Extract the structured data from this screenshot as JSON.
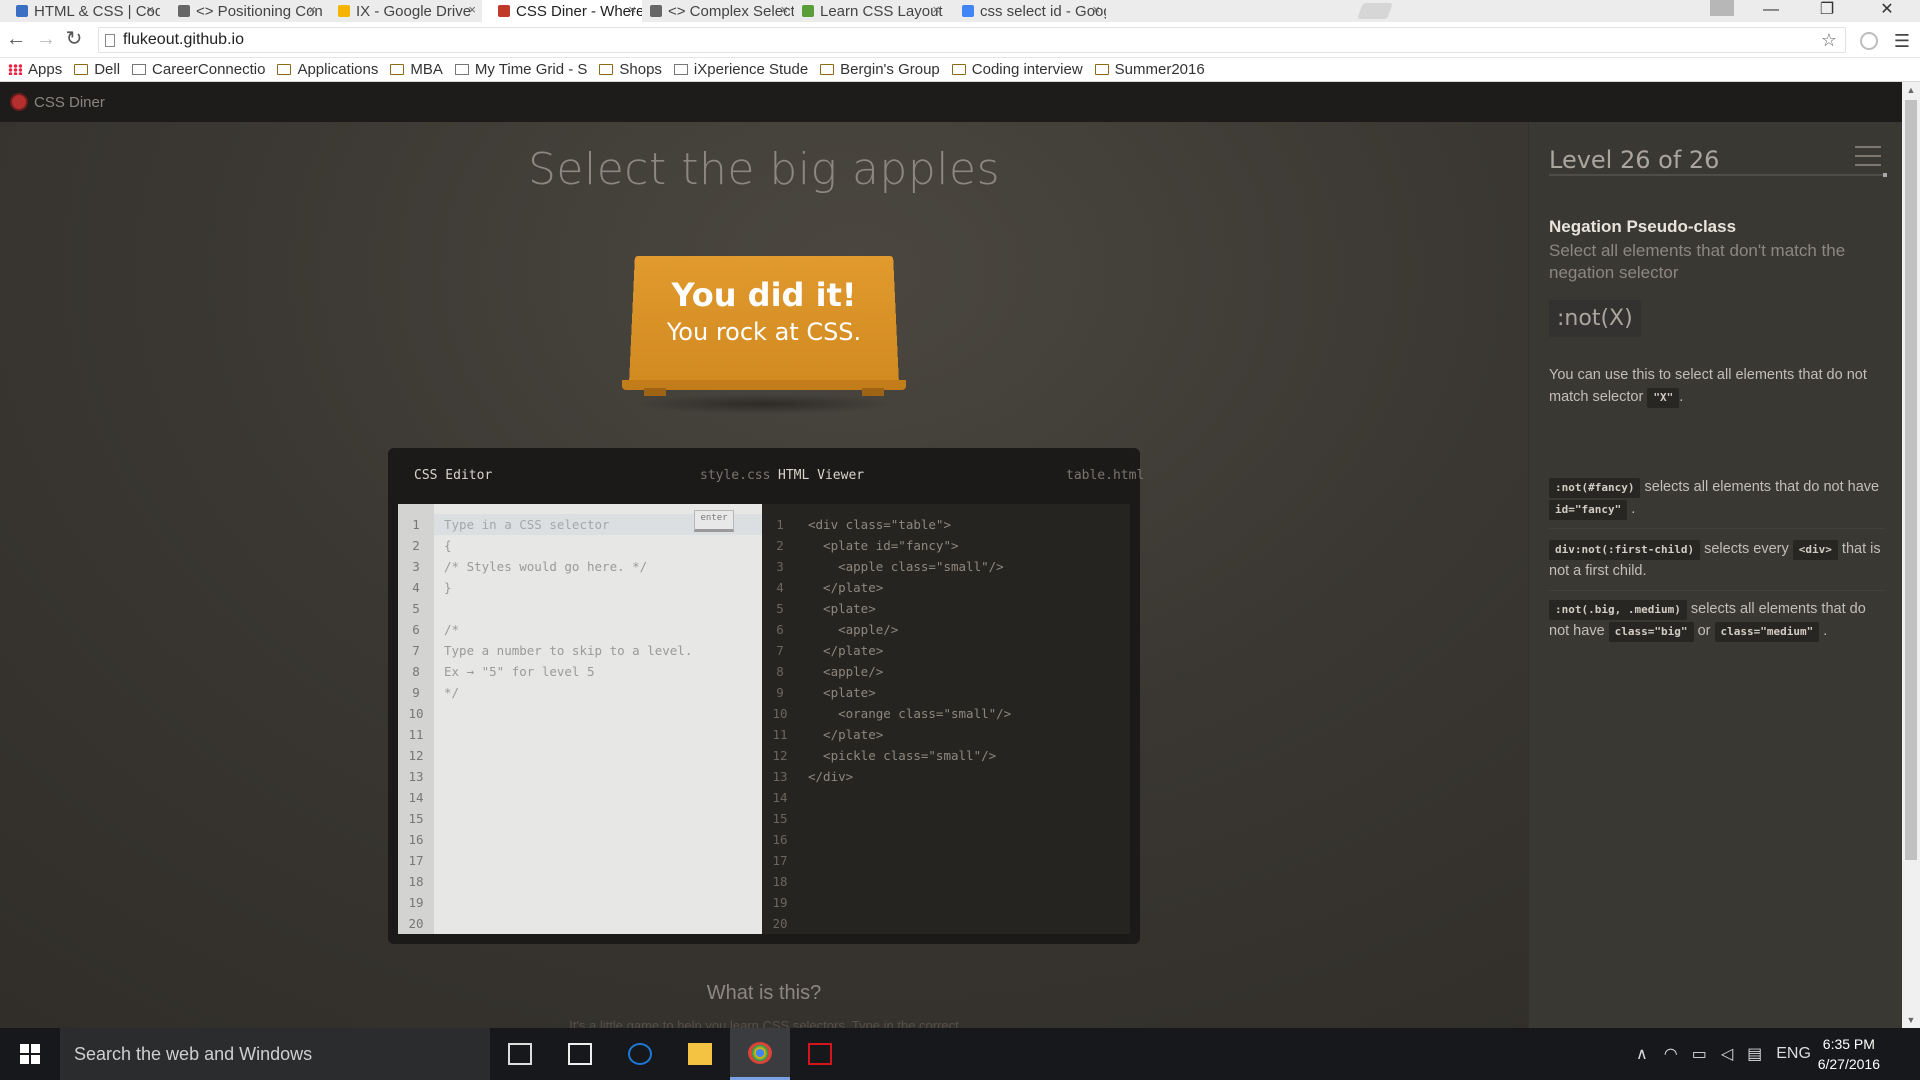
{
  "browser": {
    "tabs": [
      {
        "title": "HTML & CSS | Codec",
        "icon": "document-icon",
        "color": "#3b6fc4"
      },
      {
        "title": "<> Positioning Content",
        "icon": "code-icon",
        "color": "#666666"
      },
      {
        "title": "IX - Google Drive",
        "icon": "drive-icon",
        "color": "#f4b400"
      },
      {
        "title": "CSS Diner - Where w",
        "icon": "css-diner-icon",
        "color": "#c0392b",
        "active": true
      },
      {
        "title": "<> Complex Selectors -",
        "icon": "code-icon",
        "color": "#666666"
      },
      {
        "title": "Learn CSS Layout",
        "icon": "leaf-icon",
        "color": "#5a9e3a"
      },
      {
        "title": "css select id - Google",
        "icon": "google-icon",
        "color": "#4285f4"
      }
    ],
    "close_glyph": "×",
    "url": "flukeout.github.io",
    "bookmarks": [
      {
        "label": "Apps",
        "icon": "apps-grid-icon"
      },
      {
        "label": "Dell",
        "icon": "folder-icon"
      },
      {
        "label": "CareerConnectio",
        "icon": "page-icon"
      },
      {
        "label": "Applications",
        "icon": "folder-icon"
      },
      {
        "label": "MBA",
        "icon": "folder-icon"
      },
      {
        "label": "My Time Grid - S",
        "icon": "timegrid-icon"
      },
      {
        "label": "Shops",
        "icon": "folder-icon"
      },
      {
        "label": "iXperience Stude",
        "icon": "ix-icon"
      },
      {
        "label": "Bergin's Group",
        "icon": "folder-icon"
      },
      {
        "label": "Coding interview",
        "icon": "folder-icon"
      },
      {
        "label": "Summer2016",
        "icon": "folder-icon"
      }
    ]
  },
  "app": {
    "brand": "CSS Diner",
    "order": "Select the big apples",
    "win_line1": "You did it!",
    "win_line2": "You rock at CSS.",
    "css_editor": {
      "title": "CSS Editor",
      "file": "style.css",
      "placeholder": "Type in a CSS selector",
      "enter_label": "enter",
      "lines": [
        "",
        "{",
        "/* Styles would go here. */",
        "}",
        "",
        "/*",
        "Type a number to skip to a level.",
        "Ex → \"5\" for level 5",
        "*/",
        "",
        "",
        "",
        "",
        "",
        "",
        "",
        "",
        "",
        "",
        ""
      ]
    },
    "html_viewer": {
      "title": "HTML Viewer",
      "file": "table.html",
      "lines": [
        "<div class=\"table\">",
        "  <plate id=\"fancy\">",
        "    <apple class=\"small\"/>",
        "  </plate>",
        "  <plate>",
        "    <apple/>",
        "  </plate>",
        "  <apple/>",
        "  <plate>",
        "    <orange class=\"small\"/>",
        "  </plate>",
        "  <pickle class=\"small\"/>",
        "</div>",
        "",
        "",
        "",
        "",
        "",
        "",
        ""
      ]
    },
    "line_numbers": [
      "1",
      "2",
      "3",
      "4",
      "5",
      "6",
      "7",
      "8",
      "9",
      "10",
      "11",
      "12",
      "13",
      "14",
      "15",
      "16",
      "17",
      "18",
      "19",
      "20"
    ],
    "what_title": "What is this?",
    "what_sub": "It's a little game to help you learn CSS selectors. Type in the correct"
  },
  "sidebar": {
    "level": "Level 26 of 26",
    "selector_name": "Negation Pseudo-class",
    "title": "Select all elements that don't match the negation selector",
    "syntax": ":not(X)",
    "hint_pre": "You can use this to select all elements that do not match selector",
    "hint_code": "\"X\"",
    "hint_post": ".",
    "examples": [
      {
        "code1": ":not(#fancy)",
        "text1": "selects all elements that do not have",
        "code2": "id=\"fancy\"",
        "text2": ".",
        "code3": "",
        "text3": ""
      },
      {
        "code1": "div:not(:first-child)",
        "text1": "selects every",
        "code2": "<div>",
        "text2": "that is not a first child.",
        "code3": "",
        "text3": ""
      },
      {
        "code1": ":not(.big, .medium)",
        "text1": "selects all elements that do not have",
        "code2": "class=\"big\"",
        "text2": "or",
        "code3": "class=\"medium\"",
        "text3": "."
      }
    ]
  },
  "taskbar": {
    "search_placeholder": "Search the web and Windows",
    "apps": [
      "task-view-icon",
      "store-icon",
      "edge-icon",
      "file-explorer-icon",
      "chrome-icon",
      "acrobat-icon"
    ],
    "language": "ENG",
    "time": "6:35 PM",
    "date": "6/27/2016"
  },
  "colors": {
    "accent_orange": "#dc952b",
    "page_bg": "#3a3732",
    "editor_bg": "#1b1a18"
  }
}
